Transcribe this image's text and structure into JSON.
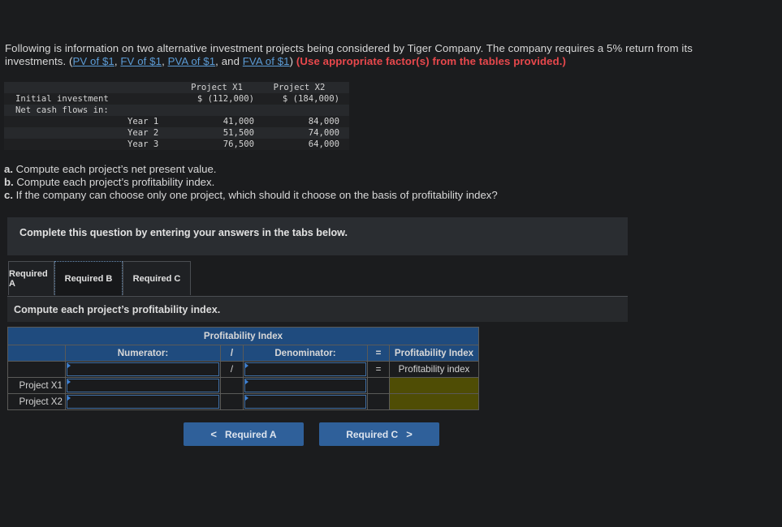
{
  "intro": {
    "text1": "Following is information on two alternative investment projects being considered by Tiger Company. The company requires a 5% return from its investments. (",
    "links": [
      "PV of $1",
      "FV of $1",
      "PVA of $1",
      "FVA of $1"
    ],
    "sep1": ", ",
    "sep2": ", ",
    "sep3": ", and ",
    "close": ")",
    "warning": "(Use appropriate factor(s) from the tables provided.)"
  },
  "data_table": {
    "headers": [
      "Project X1",
      "Project X2"
    ],
    "rows": [
      {
        "label": "Initial investment",
        "sub": "",
        "x1": "$ (112,000)",
        "x2": "$ (184,000)"
      },
      {
        "label": "Net cash flows in:",
        "sub": "",
        "x1": "",
        "x2": ""
      },
      {
        "label": "",
        "sub": "Year 1",
        "x1": "41,000",
        "x2": "84,000"
      },
      {
        "label": "",
        "sub": "Year 2",
        "x1": "51,500",
        "x2": "74,000"
      },
      {
        "label": "",
        "sub": "Year 3",
        "x1": "76,500",
        "x2": "64,000"
      }
    ]
  },
  "questions": [
    {
      "letter": "a.",
      "text": " Compute each project’s net present value."
    },
    {
      "letter": "b.",
      "text": " Compute each project’s profitability index."
    },
    {
      "letter": "c.",
      "text": " If the company can choose only one project, which should it choose on the basis of profitability index?"
    }
  ],
  "banner": "Complete this question by entering your answers in the tabs below.",
  "tabs": [
    "Required A",
    "Required B",
    "Required C"
  ],
  "active_tab": "Required B",
  "task": "Compute each project’s profitability index.",
  "pi_table": {
    "title": "Profitability Index",
    "col_numerator": "Numerator:",
    "col_div": "/",
    "col_denominator": "Denominator:",
    "col_eq": "=",
    "col_result": "Profitability Index",
    "row0": {
      "div": "/",
      "eq": "=",
      "result": "Profitability index",
      "numerator": "",
      "denominator": ""
    },
    "rows": [
      {
        "label": "Project X1",
        "numerator": "",
        "denominator": ""
      },
      {
        "label": "Project X2",
        "numerator": "",
        "denominator": ""
      }
    ]
  },
  "nav": {
    "prev_label": "Required A",
    "next_label": "Required C"
  }
}
